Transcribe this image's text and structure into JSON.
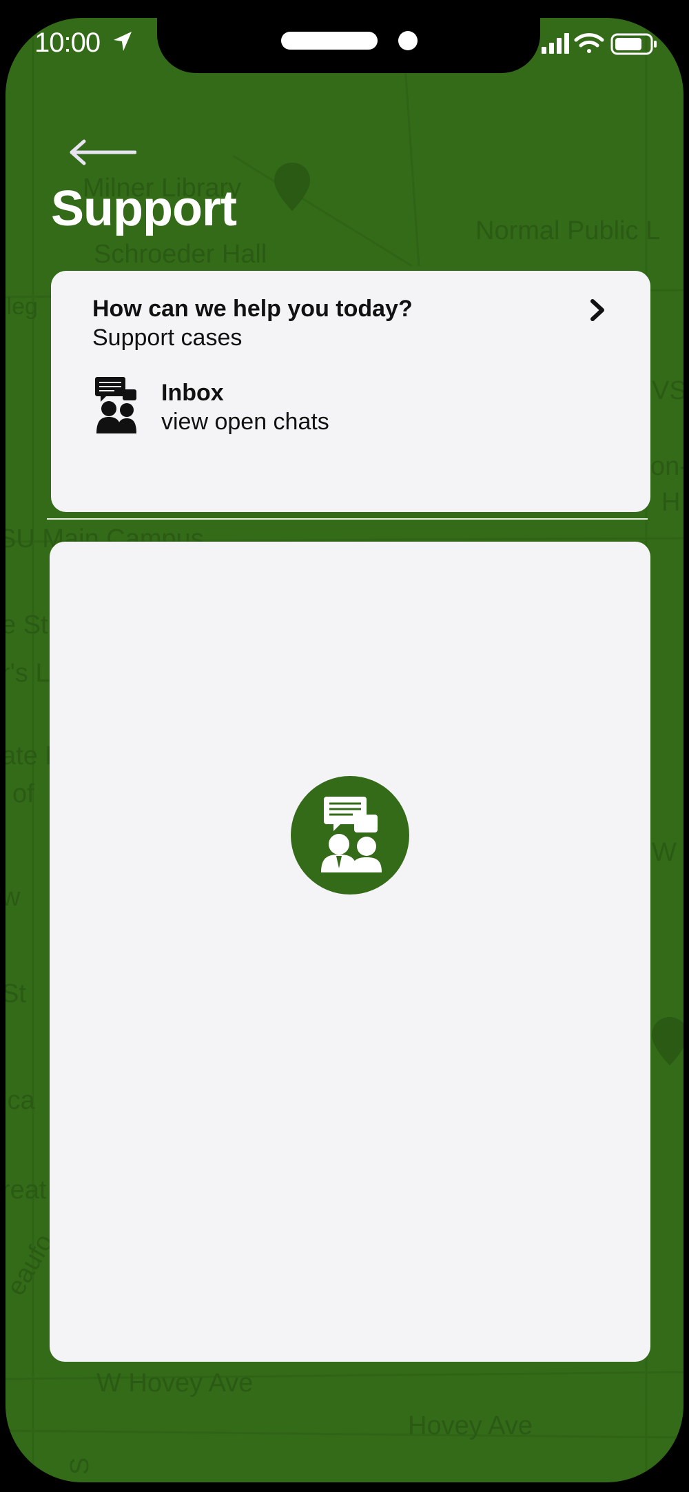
{
  "status_bar": {
    "time": "10:00"
  },
  "header": {
    "title": "Support"
  },
  "support_card": {
    "title": "How can we help you today?",
    "subtitle": "Support cases",
    "inbox": {
      "title": "Inbox",
      "subtitle": "view open chats"
    }
  },
  "map_labels": {
    "library": "Milner Library",
    "public": "Normal Public L",
    "schroeder": "Schroeder Hall",
    "college": "lleg",
    "vs": "VS",
    "on": "on-",
    "h": "H",
    "campus": "SU Main Campus",
    "est": "e St",
    "rs": "r's L",
    "ate": "ate F",
    "of": "of",
    "w1": "w",
    "w2": "W",
    "st": "St",
    "ical": "ica",
    "reat": "reat",
    "beaufort": "eaufo",
    "hovey_w": "W Hovey Ave",
    "hovey": "Hovey Ave",
    "s": "S"
  },
  "colors": {
    "brand_green": "#346b18",
    "card_bg": "#f4f4f6"
  }
}
